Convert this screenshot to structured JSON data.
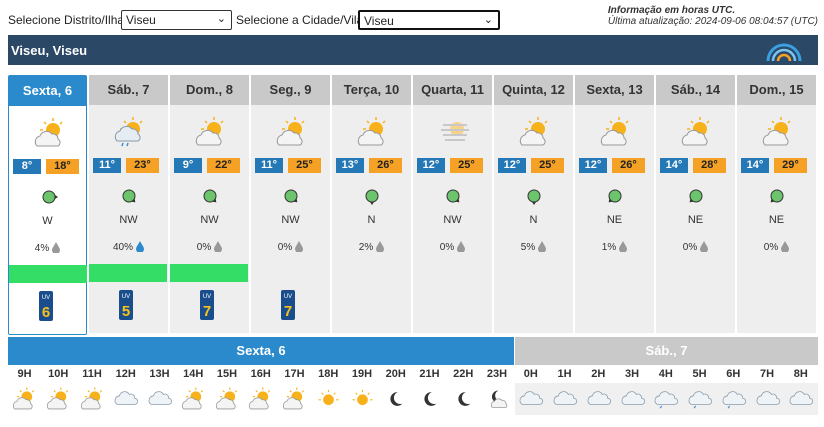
{
  "top": {
    "district_label": "Selecione Distrito/Ilha:",
    "district_value": "Viseu",
    "city_label": "Selecione a Cidade/Vila:",
    "city_value": "Viseu",
    "info_title": "Informação em horas UTC.",
    "info_update": "Última atualização: 2024-09-06 08:04:57 (UTC)"
  },
  "location": {
    "title": "Viseu, Viseu"
  },
  "days": [
    {
      "label": "Sexta, 6",
      "tmin": "8°",
      "tmax": "18°",
      "icon": "sun-cloud-icon",
      "wind": "W",
      "rain": "4%",
      "uv": "6",
      "selected": true
    },
    {
      "label": "Sáb., 7",
      "tmin": "11°",
      "tmax": "23°",
      "icon": "sun-rain-icon",
      "wind": "NW",
      "rain": "40%",
      "uv": "5"
    },
    {
      "label": "Dom., 8",
      "tmin": "9°",
      "tmax": "22°",
      "icon": "sun-cloud-icon",
      "wind": "NW",
      "rain": "0%",
      "uv": "7"
    },
    {
      "label": "Seg., 9",
      "tmin": "11°",
      "tmax": "25°",
      "icon": "sun-cloud-icon",
      "wind": "NW",
      "rain": "0%",
      "uv": "7"
    },
    {
      "label": "Terça, 10",
      "tmin": "13°",
      "tmax": "26°",
      "icon": "sun-cloud-icon",
      "wind": "N",
      "rain": "2%",
      "uv": ""
    },
    {
      "label": "Quarta, 11",
      "tmin": "12°",
      "tmax": "25°",
      "icon": "haze-icon",
      "wind": "NW",
      "rain": "0%",
      "uv": ""
    },
    {
      "label": "Quinta, 12",
      "tmin": "12°",
      "tmax": "25°",
      "icon": "sun-cloud-icon",
      "wind": "N",
      "rain": "5%",
      "uv": ""
    },
    {
      "label": "Sexta, 13",
      "tmin": "12°",
      "tmax": "26°",
      "icon": "sun-cloud-icon",
      "wind": "NE",
      "rain": "1%",
      "uv": ""
    },
    {
      "label": "Sáb., 14",
      "tmin": "14°",
      "tmax": "28°",
      "icon": "sun-cloud-icon",
      "wind": "NE",
      "rain": "0%",
      "uv": ""
    },
    {
      "label": "Dom., 15",
      "tmin": "14°",
      "tmax": "29°",
      "icon": "sun-cloud-icon",
      "wind": "NE",
      "rain": "0%",
      "uv": ""
    }
  ],
  "hourly": {
    "day1_label": "Sexta, 6",
    "day2_label": "Sáb., 7",
    "hours": [
      "9H",
      "10H",
      "11H",
      "12H",
      "13H",
      "14H",
      "15H",
      "16H",
      "17H",
      "18H",
      "19H",
      "20H",
      "21H",
      "22H",
      "23H",
      "0H",
      "1H",
      "2H",
      "3H",
      "4H",
      "5H",
      "6H",
      "7H",
      "8H"
    ],
    "icons": [
      "sun-cloud-icon",
      "sun-cloud-icon",
      "sun-cloud-icon",
      "cloud-icon",
      "cloud-icon",
      "sun-cloud-icon",
      "sun-cloud-icon",
      "sun-cloud-icon",
      "sun-cloud-icon",
      "sun-icon",
      "sun-icon",
      "moon-icon",
      "moon-icon",
      "moon-icon",
      "moon-cloud-icon",
      "cloud-icon",
      "cloud-icon",
      "cloud-icon",
      "cloud-icon",
      "cloud-drizzle-icon",
      "cloud-drizzle-icon",
      "cloud-drizzle-icon",
      "cloud-icon",
      "cloud-icon"
    ]
  },
  "colors": {
    "accent": "#2b8acb",
    "header_band": "#2b4867",
    "tmin": "#2378b5",
    "tmax": "#f4a125",
    "uv_ok": "#33dd66"
  }
}
